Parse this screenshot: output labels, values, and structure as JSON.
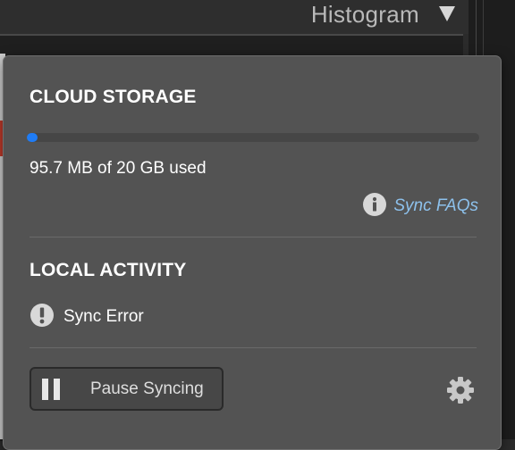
{
  "panel": {
    "title": "Histogram",
    "toggle_icon": "triangle-down-icon"
  },
  "popover": {
    "cloud_storage": {
      "title": "CLOUD STORAGE",
      "usage_text": "95.7 MB of 20 GB used",
      "used_fraction": 0.00467,
      "bar_color": "#1f7cf5",
      "faq_icon": "info-icon",
      "faq_link": "Sync FAQs",
      "link_color": "#8dc1ec"
    },
    "local_activity": {
      "title": "LOCAL ACTIVITY",
      "status_icon": "exclamation-icon",
      "status_text": "Sync Error"
    },
    "footer": {
      "pause_icon": "pause-icon",
      "pause_label": "Pause Syncing",
      "settings_icon": "gear-icon"
    }
  }
}
